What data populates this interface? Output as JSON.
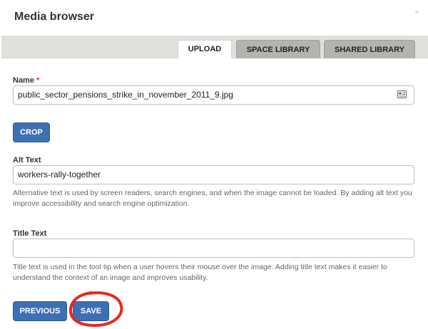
{
  "dialog": {
    "title": "Media browser",
    "close_symbol": "×"
  },
  "tabs": [
    {
      "label": "UPLOAD",
      "active": true
    },
    {
      "label": "SPACE LIBRARY",
      "active": false
    },
    {
      "label": "SHARED LIBRARY",
      "active": false
    }
  ],
  "form": {
    "name": {
      "label": "Name",
      "required_marker": "*",
      "value": "public_sector_pensions_strike_in_november_2011_9.jpg",
      "icon": "id-card-icon"
    },
    "crop_button": "CROP",
    "alt_text": {
      "label": "Alt Text",
      "value": "workers-rally-together",
      "help": "Alternative text is used by screen readers, search engines, and when the image cannot be loaded. By adding alt text you improve accessibility and search engine optimization."
    },
    "title_text": {
      "label": "Title Text",
      "value": "",
      "help": "Title text is used in the tool tip when a user hovers their mouse over the image. Adding title text makes it easier to understand the context of an image and improves usability."
    }
  },
  "footer": {
    "previous_button": "PREVIOUS",
    "save_button": "SAVE"
  },
  "colors": {
    "button_blue": "#3d6fb5",
    "tabbar_gray": "#e1e0dd",
    "inactive_tab_gray": "#b4b3ae",
    "required_red": "#e0341b",
    "annotation_red": "#e8281e"
  }
}
